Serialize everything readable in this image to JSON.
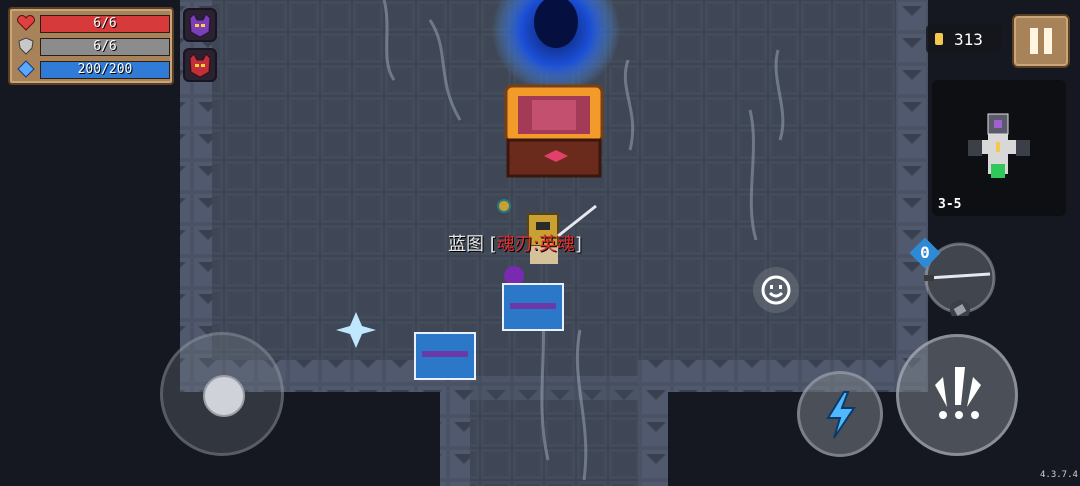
{
  "hud": {
    "health": {
      "text": "6/6",
      "current": 6,
      "max": 6,
      "color": "#d63a3a"
    },
    "armor": {
      "text": "6/6",
      "current": 6,
      "max": 6,
      "color": "#8c8c8c"
    },
    "energy": {
      "text": "200/200",
      "current": 200,
      "max": 200,
      "color": "#2f7bd6"
    },
    "buffs": [
      {
        "icon": "purple-demon-helmet-icon",
        "color": "#7b3fb8"
      },
      {
        "icon": "red-demon-helmet-icon",
        "color": "#c0303a"
      }
    ]
  },
  "coins": {
    "value": "313",
    "icon": "gold-coin-icon",
    "color": "#f2c94c"
  },
  "minimap": {
    "level": "3-5"
  },
  "weapon_pickup": {
    "prefix": "蓝图",
    "bracket_open": "[",
    "name": "魂刃:英魂",
    "bracket_close": "]",
    "name_color": "#e03030"
  },
  "weapon_switch": {
    "energy_cost": "0",
    "icon": "katana-icon"
  },
  "controls": {
    "emote_icon": "smiley-icon",
    "skill_icon": "lightning-bolt-icon",
    "attack_icon": "attack-burst-icon",
    "pause_icon": "pause-icon"
  },
  "version": "4.3.7.4"
}
